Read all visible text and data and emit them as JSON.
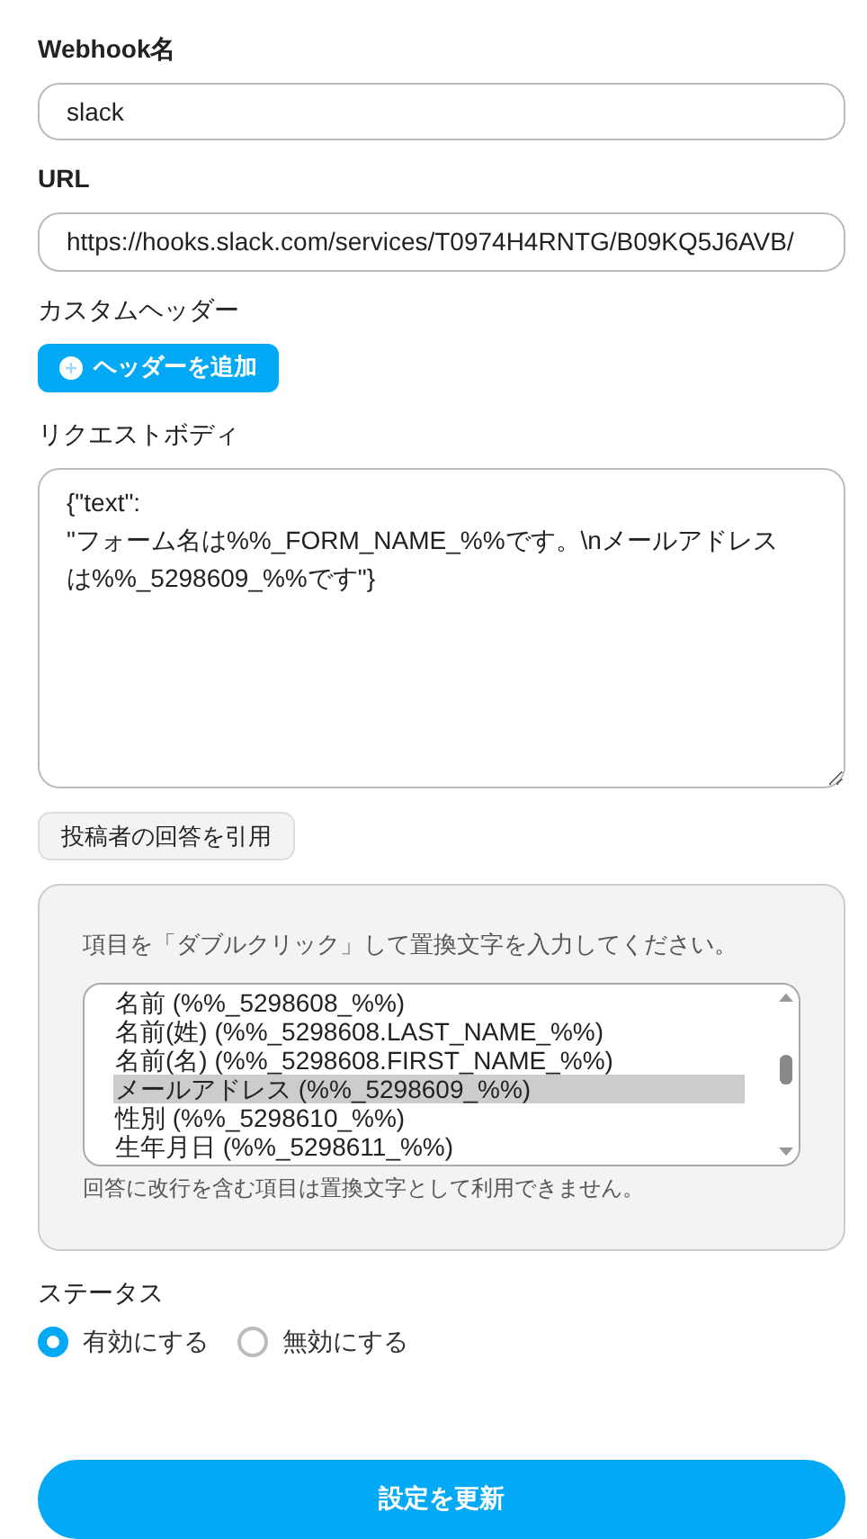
{
  "fields": [
    {
      "label": "Webhook名",
      "value": "slack"
    },
    {
      "label": "URL",
      "value": "https://hooks.slack.com/services/T0974H4RNTG/B09KQ5J6AVB/"
    }
  ],
  "custom_header": {
    "label": "カスタムヘッダー",
    "add_button": "ヘッダーを追加"
  },
  "request_body": {
    "label": "リクエストボディ",
    "value": "{\"text\":\n\"フォーム名は%%_FORM_NAME_%%です。\\nメールアドレスは%%_5298609_%%です\"}"
  },
  "quote_button": "投稿者の回答を引用",
  "quote_panel": {
    "instruction": "項目を「ダブルクリック」して置換文字を入力してください。",
    "items": [
      {
        "label": "名前 (%%_5298608_%%)",
        "selected": false
      },
      {
        "label": "名前(姓) (%%_5298608.LAST_NAME_%%)",
        "selected": false
      },
      {
        "label": "名前(名) (%%_5298608.FIRST_NAME_%%)",
        "selected": false
      },
      {
        "label": "メールアドレス (%%_5298609_%%)",
        "selected": true
      },
      {
        "label": "性別 (%%_5298610_%%)",
        "selected": false
      },
      {
        "label": "生年月日 (%%_5298611_%%)",
        "selected": false
      }
    ],
    "note": "回答に改行を含む項目は置換文字として利用できません。"
  },
  "status": {
    "label": "ステータス",
    "options": [
      {
        "label": "有効にする",
        "selected": true
      },
      {
        "label": "無効にする",
        "selected": false
      }
    ]
  },
  "submit_button": "設定を更新"
}
